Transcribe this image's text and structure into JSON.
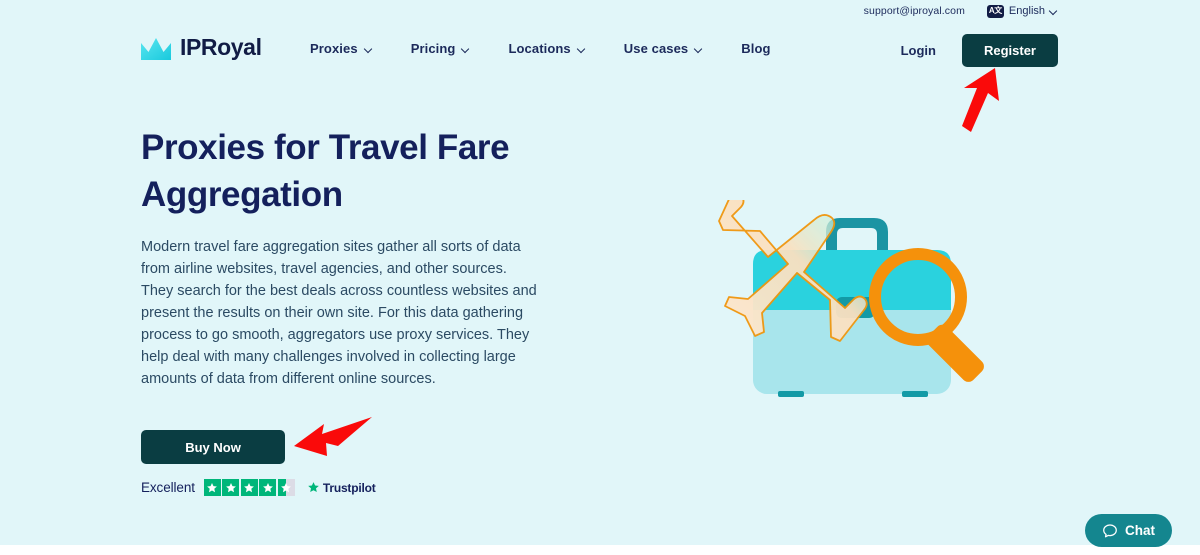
{
  "colors": {
    "page_bg": "#e1f6f9",
    "navy": "#14205c",
    "dark_teal_button": "#0a3d42",
    "brand_cyan": "#2fd4dd",
    "orange": "#f5910b",
    "trustpilot_green": "#00b67a",
    "chat_teal": "#14868f",
    "arrow_red": "#fa0a0a"
  },
  "utility": {
    "support_email": "support@iproyal.com",
    "language_icon": "translate-icon",
    "language_icon_glyph": "A文",
    "language": "English",
    "caret_icon": "chevron-down-icon"
  },
  "header": {
    "logo_mark": "crown-logo-icon",
    "logo_text": "IPRoyal",
    "nav": [
      {
        "label": "Proxies",
        "has_caret": true
      },
      {
        "label": "Pricing",
        "has_caret": true
      },
      {
        "label": "Locations",
        "has_caret": true
      },
      {
        "label": "Use cases",
        "has_caret": true
      },
      {
        "label": "Blog",
        "has_caret": false
      }
    ],
    "login_label": "Login",
    "register_label": "Register"
  },
  "hero": {
    "title": "Proxies for Travel Fare Aggregation",
    "paragraph": "Modern travel fare aggregation sites gather all sorts of data from airline websites, travel agencies, and other sources. They search for the best deals across countless websites and present the results on their own site. For this data gathering process to go smooth, aggregators use proxy services. They help deal with many challenges involved in collecting large amounts of data from different online sources.",
    "cta_label": "Buy Now",
    "illustration": "travel-suitcase-airplane-magnifier-illustration"
  },
  "trustpilot": {
    "rating_word": "Excellent",
    "stars_total": 5,
    "stars_filled": 4,
    "half_star": true,
    "rating_value": "4.5",
    "brand_name": "Trustpilot",
    "brand_star_icon": "trustpilot-star-icon"
  },
  "annotations": [
    {
      "name": "arrow-pointing-to-register",
      "target": "Register"
    },
    {
      "name": "arrow-pointing-to-buy-now",
      "target": "Buy Now"
    }
  ],
  "chat": {
    "icon": "chat-bubble-icon",
    "label": "Chat"
  }
}
